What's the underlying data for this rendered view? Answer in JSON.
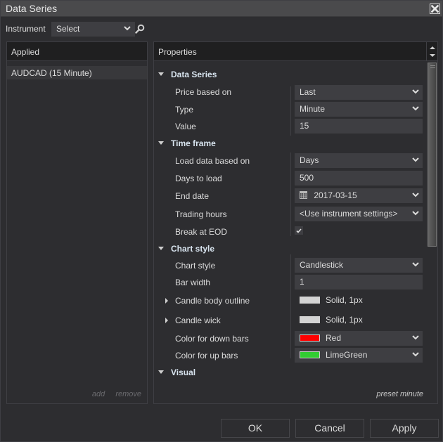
{
  "window": {
    "title": "Data Series",
    "close_icon": "close-icon"
  },
  "instrument": {
    "label": "Instrument",
    "select_value": "Select",
    "search_icon": "search-icon"
  },
  "applied": {
    "header": "Applied",
    "items": [
      {
        "label": "AUDCAD (15 Minute)",
        "selected": true
      }
    ],
    "add_label": "add",
    "remove_label": "remove"
  },
  "properties": {
    "header": "Properties",
    "scroll_position": 0,
    "preset_label": "preset minute",
    "categories": {
      "data_series": {
        "label": "Data Series",
        "expanded": true,
        "price_based_on": {
          "label": "Price based on",
          "value": "Last"
        },
        "type": {
          "label": "Type",
          "value": "Minute"
        },
        "value": {
          "label": "Value",
          "value": "15"
        }
      },
      "time_frame": {
        "label": "Time frame",
        "expanded": true,
        "load_data_based_on": {
          "label": "Load data based on",
          "value": "Days"
        },
        "days_to_load": {
          "label": "Days to load",
          "value": "500"
        },
        "end_date": {
          "label": "End date",
          "value": "2017-03-15"
        },
        "trading_hours": {
          "label": "Trading hours",
          "value": "<Use instrument settings>"
        },
        "break_at_eod": {
          "label": "Break at EOD",
          "checked": true
        }
      },
      "chart_style": {
        "label": "Chart style",
        "expanded": true,
        "chart_style": {
          "label": "Chart style",
          "value": "Candlestick"
        },
        "bar_width": {
          "label": "Bar width",
          "value": "1"
        },
        "candle_body_outline": {
          "label": "Candle body outline",
          "value": "Solid, 1px",
          "color": "#d3d3d3"
        },
        "candle_wick": {
          "label": "Candle wick",
          "value": "Solid, 1px",
          "color": "#d3d3d3"
        },
        "color_down_bars": {
          "label": "Color for down bars",
          "value": "Red",
          "color": "#ff0000"
        },
        "color_up_bars": {
          "label": "Color for up bars",
          "value": "LimeGreen",
          "color": "#32cd32"
        }
      },
      "visual": {
        "label": "Visual",
        "expanded": true
      }
    }
  },
  "buttons": {
    "ok": "OK",
    "cancel": "Cancel",
    "apply": "Apply"
  }
}
